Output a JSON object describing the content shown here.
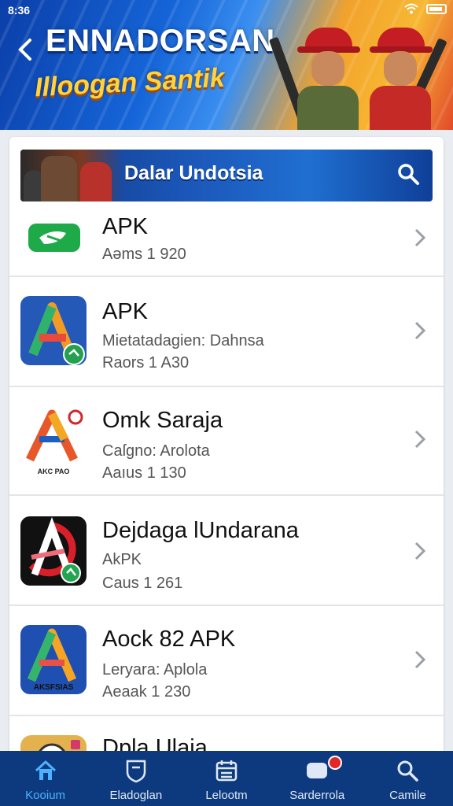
{
  "status_bar": {
    "time": "8:36"
  },
  "header": {
    "back_icon": "chevron-left-icon",
    "title": "ENNADORSAN",
    "subtitle": "Illoogan Santik"
  },
  "search_banner": {
    "label": "Dalar Undotsia",
    "icon": "search-icon"
  },
  "apps": [
    {
      "title": "APK",
      "lines": [
        "Aəms 1 920"
      ],
      "icon_color": "#1faa4a"
    },
    {
      "title": "APK",
      "lines": [
        "Mietatadagien: Dahnsa",
        "Raors 1 A30"
      ],
      "icon_color": "#2459b8"
    },
    {
      "title": "Omk Saraja",
      "lines": [
        "Caſgno: Arolota",
        "Aaıus 1 130"
      ],
      "icon_color": "#e8572a",
      "icon_caption": "AKC PAO"
    },
    {
      "title": "Dejdaga lUndarana",
      "lines": [
        "AkPK",
        "Caus 1 261"
      ],
      "icon_color": "#111111"
    },
    {
      "title": "Aock 82 APK",
      "lines": [
        "Leryara: Aplola",
        "Aeaak 1 230"
      ],
      "icon_color": "#1f4fb0",
      "icon_caption": "AKSFSIAS"
    },
    {
      "title": "Dpla Ulaia",
      "lines": [],
      "icon_color": "#e4b24c"
    }
  ],
  "bottom_nav": [
    {
      "label": "Kooium",
      "icon": "home-icon",
      "active": true
    },
    {
      "label": "Eladoglan",
      "icon": "shield-icon",
      "active": false
    },
    {
      "label": "Lelootm",
      "icon": "calendar-icon",
      "active": false
    },
    {
      "label": "Sarderrola",
      "icon": "chat-icon",
      "active": false,
      "badge": true
    },
    {
      "label": "Camile",
      "icon": "search-icon",
      "active": false
    }
  ]
}
